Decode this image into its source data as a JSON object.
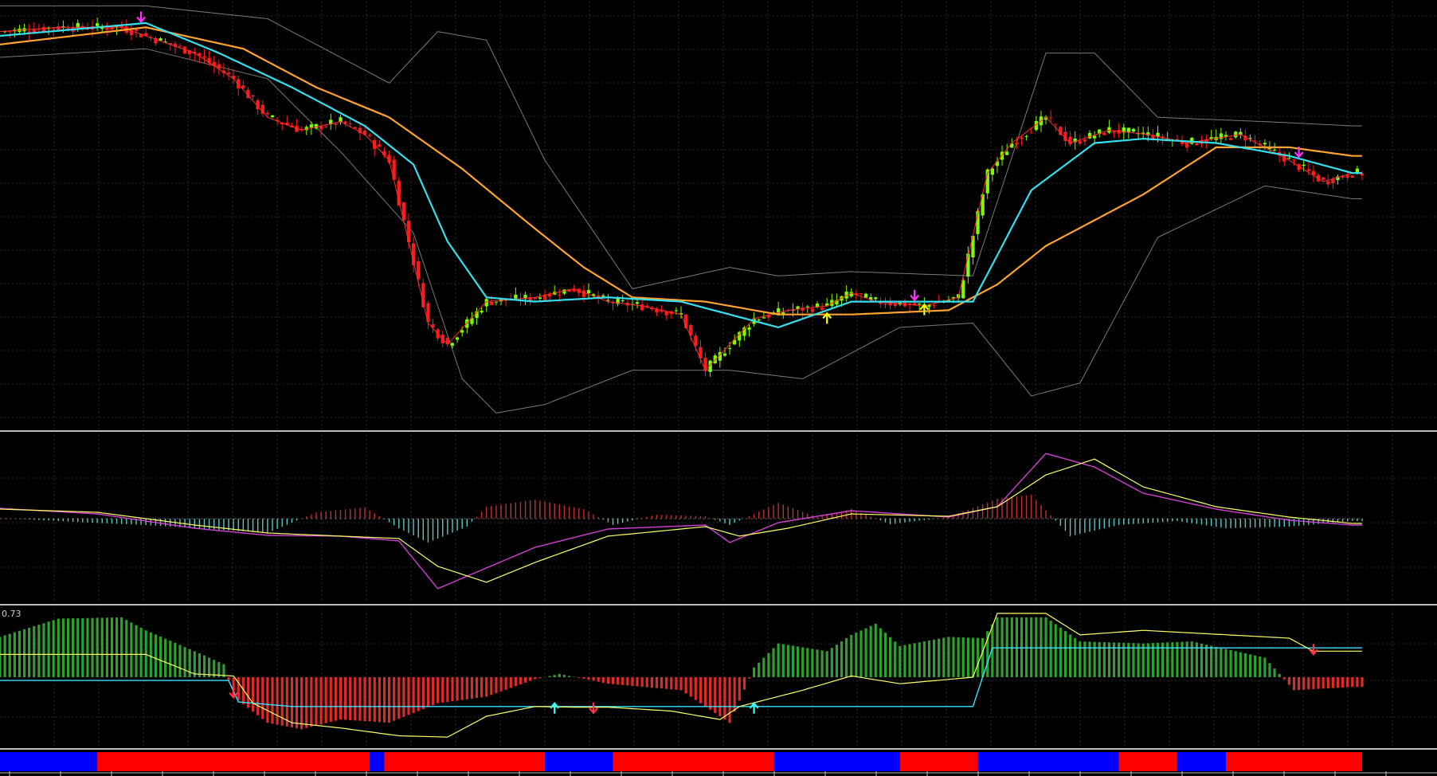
{
  "colors": {
    "background": "#000000",
    "grid": "#2a2a2a",
    "separator": "#bdbdbd",
    "bull_candle": "#7cfc00",
    "bear_candle": "#ff1a1a",
    "fast_ma": "#34e0f0",
    "slow_ma": "#ffa22e",
    "short_ma": "#ff2a2a",
    "bands": "#7a7a7a",
    "arrow_magenta": "#ff33ff",
    "arrow_yellow": "#ffff00",
    "arrow_cyan": "#33ffff",
    "arrow_red": "#ff3344",
    "macd_signal_magenta": "#d040d0",
    "macd_line_yellow": "#ffff66",
    "hist_pos": "#c03030",
    "hist_neg": "#5fc4c4",
    "ind2_pos": "#2ea02e",
    "ind2_neg": "#e02a2a",
    "ind2_yellow": "#ffff66",
    "ind2_cyan": "#3ce0ff",
    "trend_bar_red": "#ff0000",
    "trend_bar_blue": "#0000ff"
  },
  "icons": {
    "arrow_up": "arrow-up-icon",
    "arrow_down": "arrow-down-icon"
  },
  "chart_data": [
    {
      "type": "candlestick",
      "panel": "price",
      "title": "",
      "xlabel": "",
      "ylabel": "",
      "x_range": [
        0,
        280
      ],
      "y_range": [
        0,
        100
      ],
      "grid": true,
      "ohlc_anchors": [
        [
          0,
          93
        ],
        [
          12,
          94
        ],
        [
          25,
          94
        ],
        [
          30,
          92
        ],
        [
          40,
          88
        ],
        [
          48,
          82
        ],
        [
          55,
          73
        ],
        [
          62,
          70
        ],
        [
          70,
          72
        ],
        [
          75,
          69
        ],
        [
          80,
          63
        ],
        [
          84,
          44
        ],
        [
          88,
          25
        ],
        [
          92,
          20
        ],
        [
          100,
          30
        ],
        [
          110,
          31
        ],
        [
          118,
          33
        ],
        [
          125,
          30
        ],
        [
          132,
          29
        ],
        [
          140,
          27
        ],
        [
          145,
          14
        ],
        [
          150,
          20
        ],
        [
          155,
          26
        ],
        [
          162,
          28
        ],
        [
          170,
          29
        ],
        [
          175,
          32
        ],
        [
          180,
          30
        ],
        [
          190,
          29
        ],
        [
          197,
          31
        ],
        [
          203,
          60
        ],
        [
          208,
          67
        ],
        [
          215,
          73
        ],
        [
          220,
          67
        ],
        [
          228,
          70
        ],
        [
          236,
          69
        ],
        [
          244,
          67
        ],
        [
          255,
          69
        ],
        [
          265,
          63
        ],
        [
          272,
          58
        ],
        [
          278,
          60
        ]
      ],
      "fast_ma_anchors": [
        [
          0,
          92
        ],
        [
          30,
          95
        ],
        [
          45,
          88
        ],
        [
          60,
          80
        ],
        [
          75,
          71
        ],
        [
          85,
          62
        ],
        [
          92,
          44
        ],
        [
          100,
          31
        ],
        [
          110,
          30
        ],
        [
          125,
          31
        ],
        [
          140,
          30
        ],
        [
          160,
          24
        ],
        [
          175,
          30
        ],
        [
          190,
          30
        ],
        [
          200,
          30
        ],
        [
          212,
          56
        ],
        [
          225,
          67
        ],
        [
          235,
          68
        ],
        [
          250,
          67
        ],
        [
          265,
          64
        ],
        [
          278,
          60
        ]
      ],
      "slow_ma_anchors": [
        [
          0,
          90
        ],
        [
          30,
          94
        ],
        [
          50,
          89
        ],
        [
          65,
          80
        ],
        [
          80,
          73
        ],
        [
          95,
          61
        ],
        [
          110,
          47
        ],
        [
          120,
          38
        ],
        [
          130,
          31
        ],
        [
          145,
          30
        ],
        [
          160,
          27
        ],
        [
          175,
          27
        ],
        [
          195,
          28
        ],
        [
          205,
          34
        ],
        [
          215,
          43
        ],
        [
          235,
          55
        ],
        [
          250,
          66
        ],
        [
          265,
          66
        ],
        [
          278,
          64
        ]
      ],
      "upper_band_anchors": [
        [
          0,
          99
        ],
        [
          30,
          99
        ],
        [
          55,
          96
        ],
        [
          80,
          81
        ],
        [
          90,
          93
        ],
        [
          100,
          91
        ],
        [
          112,
          63
        ],
        [
          130,
          33
        ],
        [
          150,
          38
        ],
        [
          160,
          36
        ],
        [
          175,
          37
        ],
        [
          200,
          36
        ],
        [
          215,
          88
        ],
        [
          225,
          88
        ],
        [
          238,
          73
        ],
        [
          260,
          72
        ],
        [
          278,
          71
        ]
      ],
      "lower_band_anchors": [
        [
          0,
          87
        ],
        [
          30,
          89
        ],
        [
          55,
          82
        ],
        [
          70,
          65
        ],
        [
          85,
          46
        ],
        [
          95,
          12
        ],
        [
          102,
          4
        ],
        [
          112,
          6
        ],
        [
          130,
          14
        ],
        [
          150,
          14
        ],
        [
          165,
          12
        ],
        [
          185,
          24
        ],
        [
          200,
          25
        ],
        [
          212,
          8
        ],
        [
          222,
          11
        ],
        [
          238,
          45
        ],
        [
          260,
          57
        ],
        [
          278,
          54
        ]
      ],
      "arrows": [
        {
          "x": 29,
          "direction": "down",
          "color": "magenta"
        },
        {
          "x": 170,
          "direction": "up",
          "color": "yellow"
        },
        {
          "x": 188,
          "direction": "down",
          "color": "magenta"
        },
        {
          "x": 190,
          "direction": "up",
          "color": "yellow"
        },
        {
          "x": 267,
          "direction": "down",
          "color": "magenta"
        }
      ]
    },
    {
      "type": "histogram-with-lines",
      "panel": "macd",
      "title": "",
      "xlabel": "",
      "ylabel": "",
      "x_range": [
        0,
        280
      ],
      "y_range": [
        -1,
        1
      ],
      "grid": true,
      "histogram_anchors": [
        [
          0,
          0.01
        ],
        [
          15,
          -0.04
        ],
        [
          30,
          -0.08
        ],
        [
          45,
          -0.14
        ],
        [
          55,
          -0.18
        ],
        [
          65,
          0.08
        ],
        [
          75,
          0.14
        ],
        [
          82,
          -0.12
        ],
        [
          88,
          -0.3
        ],
        [
          96,
          -0.1
        ],
        [
          100,
          0.15
        ],
        [
          110,
          0.24
        ],
        [
          120,
          0.12
        ],
        [
          126,
          -0.08
        ],
        [
          135,
          0.05
        ],
        [
          145,
          0.03
        ],
        [
          150,
          -0.08
        ],
        [
          160,
          0.2
        ],
        [
          168,
          0.02
        ],
        [
          175,
          0.12
        ],
        [
          183,
          -0.07
        ],
        [
          195,
          0.02
        ],
        [
          205,
          0.25
        ],
        [
          212,
          0.3
        ],
        [
          220,
          -0.22
        ],
        [
          230,
          -0.08
        ],
        [
          242,
          -0.03
        ],
        [
          252,
          -0.12
        ],
        [
          265,
          -0.1
        ],
        [
          278,
          -0.03
        ]
      ],
      "line_magenta_anchors": [
        [
          0,
          0.13
        ],
        [
          20,
          0.06
        ],
        [
          40,
          -0.12
        ],
        [
          55,
          -0.21
        ],
        [
          70,
          -0.22
        ],
        [
          82,
          -0.28
        ],
        [
          90,
          -0.88
        ],
        [
          100,
          -0.62
        ],
        [
          110,
          -0.36
        ],
        [
          125,
          -0.13
        ],
        [
          145,
          -0.08
        ],
        [
          150,
          -0.3
        ],
        [
          160,
          -0.05
        ],
        [
          175,
          0.1
        ],
        [
          195,
          0.02
        ],
        [
          205,
          0.15
        ],
        [
          215,
          0.82
        ],
        [
          225,
          0.65
        ],
        [
          235,
          0.32
        ],
        [
          250,
          0.12
        ],
        [
          265,
          -0.02
        ],
        [
          278,
          -0.08
        ]
      ],
      "line_yellow_anchors": [
        [
          0,
          0.12
        ],
        [
          20,
          0.08
        ],
        [
          40,
          -0.08
        ],
        [
          55,
          -0.18
        ],
        [
          70,
          -0.22
        ],
        [
          82,
          -0.25
        ],
        [
          90,
          -0.6
        ],
        [
          100,
          -0.8
        ],
        [
          110,
          -0.55
        ],
        [
          125,
          -0.22
        ],
        [
          145,
          -0.1
        ],
        [
          152,
          -0.22
        ],
        [
          162,
          -0.12
        ],
        [
          175,
          0.06
        ],
        [
          195,
          0.03
        ],
        [
          205,
          0.15
        ],
        [
          215,
          0.55
        ],
        [
          225,
          0.75
        ],
        [
          235,
          0.4
        ],
        [
          250,
          0.15
        ],
        [
          265,
          0.02
        ],
        [
          278,
          -0.06
        ]
      ]
    },
    {
      "type": "histogram-with-lines",
      "panel": "oscillator",
      "title": "",
      "xlabel": "",
      "ylabel": "",
      "top_label": "0.73",
      "x_range": [
        0,
        280
      ],
      "y_range": [
        -1,
        1
      ],
      "grid": true,
      "histogram_anchors": [
        [
          0,
          0.62
        ],
        [
          12,
          0.9
        ],
        [
          25,
          0.92
        ],
        [
          30,
          0.72
        ],
        [
          40,
          0.4
        ],
        [
          46,
          0.2
        ],
        [
          48,
          -0.3
        ],
        [
          55,
          -0.7
        ],
        [
          62,
          -0.8
        ],
        [
          70,
          -0.65
        ],
        [
          80,
          -0.7
        ],
        [
          90,
          -0.4
        ],
        [
          100,
          -0.3
        ],
        [
          110,
          -0.03
        ],
        [
          115,
          0.05
        ],
        [
          125,
          -0.1
        ],
        [
          140,
          -0.2
        ],
        [
          150,
          -0.7
        ],
        [
          155,
          0.15
        ],
        [
          160,
          0.52
        ],
        [
          170,
          0.4
        ],
        [
          175,
          0.65
        ],
        [
          180,
          0.82
        ],
        [
          185,
          0.48
        ],
        [
          195,
          0.62
        ],
        [
          202,
          0.6
        ],
        [
          205,
          0.92
        ],
        [
          215,
          0.92
        ],
        [
          222,
          0.55
        ],
        [
          235,
          0.52
        ],
        [
          245,
          0.55
        ],
        [
          260,
          0.3
        ],
        [
          266,
          -0.2
        ],
        [
          278,
          -0.15
        ]
      ],
      "line_yellow_anchors": [
        [
          0,
          0.35
        ],
        [
          30,
          0.35
        ],
        [
          40,
          0.05
        ],
        [
          48,
          0.02
        ],
        [
          52,
          -0.4
        ],
        [
          60,
          -0.7
        ],
        [
          70,
          -0.78
        ],
        [
          82,
          -0.9
        ],
        [
          92,
          -0.92
        ],
        [
          100,
          -0.6
        ],
        [
          110,
          -0.45
        ],
        [
          118,
          -0.46
        ],
        [
          125,
          -0.46
        ],
        [
          138,
          -0.52
        ],
        [
          148,
          -0.65
        ],
        [
          152,
          -0.45
        ],
        [
          165,
          -0.2
        ],
        [
          175,
          0.02
        ],
        [
          185,
          -0.1
        ],
        [
          200,
          0.0
        ],
        [
          205,
          0.98
        ],
        [
          215,
          0.98
        ],
        [
          222,
          0.65
        ],
        [
          235,
          0.72
        ],
        [
          245,
          0.68
        ],
        [
          265,
          0.6
        ],
        [
          270,
          0.4
        ],
        [
          278,
          0.4
        ]
      ],
      "line_cyan_anchors": [
        [
          0,
          -0.05
        ],
        [
          47,
          -0.05
        ],
        [
          49,
          -0.38
        ],
        [
          60,
          -0.45
        ],
        [
          100,
          -0.45
        ],
        [
          200,
          -0.45
        ],
        [
          204,
          0.45
        ],
        [
          278,
          0.45
        ]
      ],
      "arrows": [
        {
          "x": 48,
          "direction": "down",
          "color": "red"
        },
        {
          "x": 114,
          "direction": "up",
          "color": "cyan"
        },
        {
          "x": 122,
          "direction": "down",
          "color": "red"
        },
        {
          "x": 155,
          "direction": "up",
          "color": "cyan"
        },
        {
          "x": 270,
          "direction": "down",
          "color": "red"
        }
      ]
    },
    {
      "type": "trend-bar",
      "panel": "trend",
      "title": "",
      "x_range": [
        0,
        280
      ],
      "segments": [
        {
          "start": 0,
          "end": 20,
          "color": "blue"
        },
        {
          "start": 20,
          "end": 76,
          "color": "red"
        },
        {
          "start": 76,
          "end": 79,
          "color": "blue"
        },
        {
          "start": 79,
          "end": 112,
          "color": "red"
        },
        {
          "start": 112,
          "end": 126,
          "color": "blue"
        },
        {
          "start": 126,
          "end": 159,
          "color": "red"
        },
        {
          "start": 159,
          "end": 185,
          "color": "blue"
        },
        {
          "start": 185,
          "end": 201,
          "color": "red"
        },
        {
          "start": 201,
          "end": 230,
          "color": "blue"
        },
        {
          "start": 230,
          "end": 242,
          "color": "red"
        },
        {
          "start": 242,
          "end": 252,
          "color": "blue"
        },
        {
          "start": 252,
          "end": 281,
          "color": "red"
        }
      ]
    }
  ]
}
